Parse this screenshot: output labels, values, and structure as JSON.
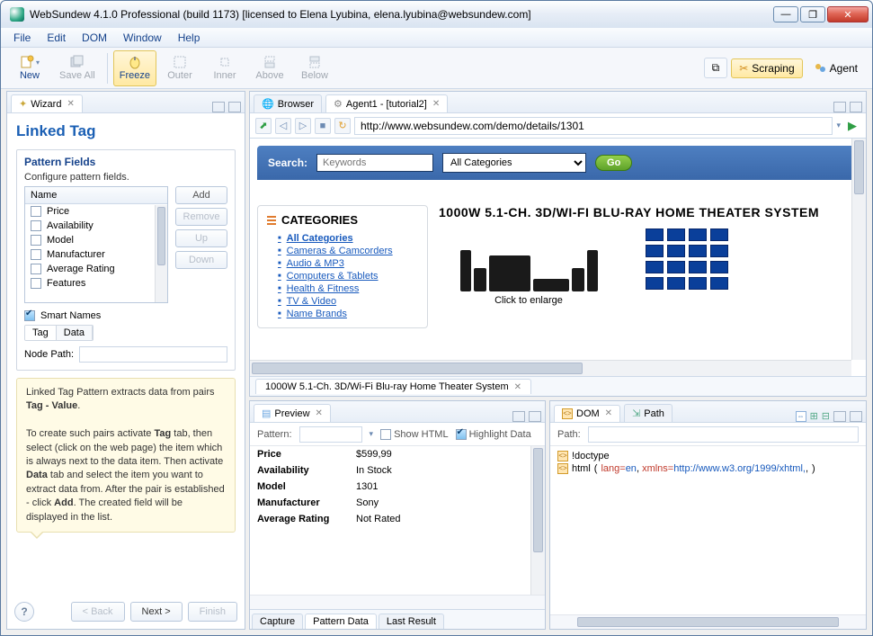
{
  "window": {
    "title": "WebSundew 4.1.0 Professional (build 1173) [licensed to Elena Lyubina, elena.lyubina@websundew.com]"
  },
  "menubar": [
    "File",
    "Edit",
    "DOM",
    "Window",
    "Help"
  ],
  "toolbar": {
    "new": "New",
    "saveall": "Save All",
    "freeze": "Freeze",
    "outer": "Outer",
    "inner": "Inner",
    "above": "Above",
    "below": "Below",
    "scraping": "Scraping",
    "agent": "Agent"
  },
  "wizard": {
    "tab": "Wizard",
    "title": "Linked Tag",
    "group_title": "Pattern Fields",
    "group_sub": "Configure pattern fields.",
    "list_header": "Name",
    "fields": [
      "Price",
      "Availability",
      "Model",
      "Manufacturer",
      "Average Rating",
      "Features"
    ],
    "buttons": {
      "add": "Add",
      "remove": "Remove",
      "up": "Up",
      "down": "Down"
    },
    "smart": "Smart Names",
    "tagdata": {
      "tag": "Tag",
      "data": "Data"
    },
    "node_path_label": "Node Path:",
    "node_path_value": "",
    "hint_html": "Linked Tag Pattern extracts data from pairs <b>Tag - Value</b>.<br><br>To create such pairs activate <b>Tag</b> tab, then select (click on the web page) the item which is always next to the data item. Then activate <b>Data</b> tab and select the item you want to extract data from. After the pair is established - click <b>Add</b>. The created field will be displayed in the list.",
    "nav": {
      "back": "< Back",
      "next": "Next >",
      "finish": "Finish"
    }
  },
  "browser": {
    "tabs": {
      "browser": "Browser",
      "agent": "Agent1 - [tutorial2]"
    },
    "url": "http://www.websundew.com/demo/details/1301",
    "page_tab": "1000W 5.1-Ch. 3D/Wi-Fi Blu-ray Home Theater System"
  },
  "demo_page": {
    "search_label": "Search:",
    "search_placeholder": "Keywords",
    "category_selected": "All Categories",
    "go": "Go",
    "cat_heading": "CATEGORIES",
    "categories": [
      "All Categories",
      "Cameras & Camcorders",
      "Audio & MP3",
      "Computers & Tablets",
      "Health & Fitness",
      "TV & Video",
      "Name Brands"
    ],
    "product_title": "1000W 5.1-CH. 3D/WI-FI BLU-RAY HOME THEATER SYSTEM",
    "enlarge": "Click to enlarge"
  },
  "preview": {
    "tab": "Preview",
    "pattern_label": "Pattern:",
    "show_html": "Show HTML",
    "highlight": "Highlight Data",
    "rows": [
      {
        "k": "Price",
        "v": "$599,99"
      },
      {
        "k": "Availability",
        "v": "In Stock"
      },
      {
        "k": "Model",
        "v": "1301"
      },
      {
        "k": "Manufacturer",
        "v": "Sony"
      },
      {
        "k": "Average Rating",
        "v": "Not Rated"
      }
    ],
    "foot": [
      "Capture",
      "Pattern Data",
      "Last Result"
    ]
  },
  "dom": {
    "tab_dom": "DOM",
    "tab_path": "Path",
    "path_label": "Path:",
    "nodes": {
      "doctype": "!doctype",
      "html": "html",
      "attrs": "lang=en, xmlns=http://www.w3.org/1999/xhtml,"
    }
  }
}
